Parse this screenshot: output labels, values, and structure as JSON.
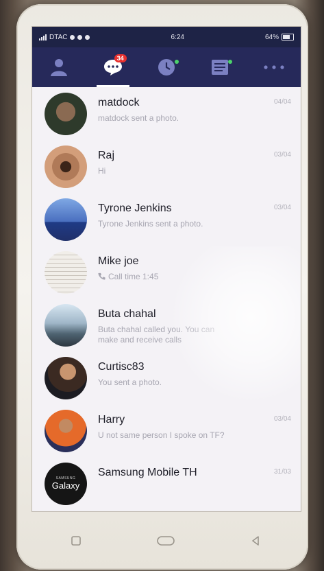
{
  "status": {
    "carrier": "DTAC",
    "time": "6:24",
    "battery": "64%"
  },
  "tabs": [
    {
      "icon": "friends-icon"
    },
    {
      "icon": "chats-icon",
      "badge": "34"
    },
    {
      "icon": "timeline-icon"
    },
    {
      "icon": "news-icon"
    },
    {
      "icon": "more-icon"
    }
  ],
  "chats": [
    {
      "name": "matdock",
      "preview": "matdock sent a photo.",
      "date": "04/04"
    },
    {
      "name": "Raj",
      "preview": "Hi",
      "date": "03/04"
    },
    {
      "name": "Tyrone Jenkins",
      "preview": "Tyrone Jenkins sent a photo.",
      "date": "03/04"
    },
    {
      "name": "Mike joe",
      "preview": "Call time 1:45",
      "date": ""
    },
    {
      "name": "Buta chahal",
      "preview": "Buta chahal called you. You can",
      "preview2": "make and receive calls",
      "date": ""
    },
    {
      "name": "Curtisc83",
      "preview": "You sent a photo.",
      "date": ""
    },
    {
      "name": "Harry",
      "preview": "U not same person I spoke on TF?",
      "date": "03/04"
    },
    {
      "name": "Samsung Mobile TH",
      "preview": "",
      "date": "31/03",
      "avatar_text": "Galaxy",
      "avatar_small": "SAMSUNG"
    }
  ]
}
